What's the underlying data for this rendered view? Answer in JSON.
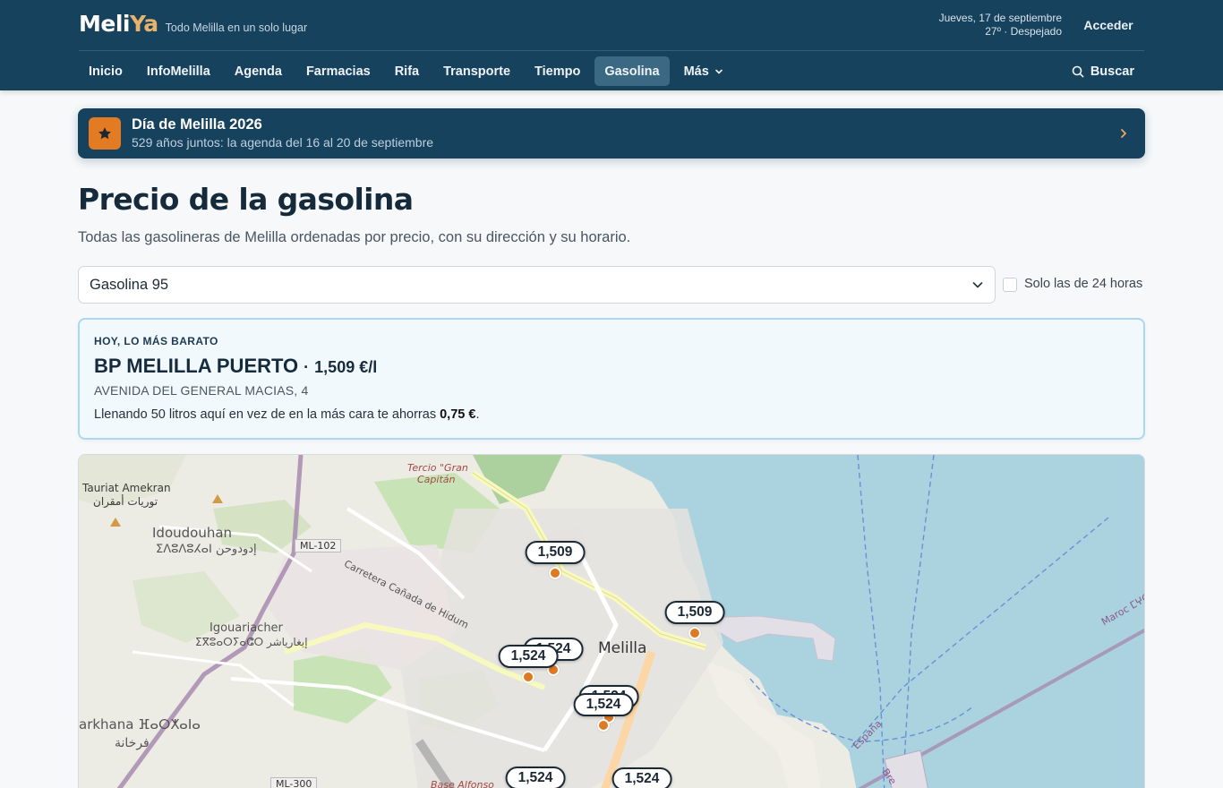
{
  "header": {
    "logo_part1": "Meli",
    "logo_part2": "Ya",
    "tagline": "Todo Melilla en un solo lugar",
    "date": "Jueves, 17 de septiembre",
    "weather": "27º · Despejado",
    "login_label": "Acceder",
    "nav": [
      "Inicio",
      "InfoMelilla",
      "Agenda",
      "Farmacias",
      "Rifa",
      "Transporte",
      "Tiempo",
      "Gasolina"
    ],
    "nav_more": "Más",
    "nav_active": "Gasolina",
    "search_label": "Buscar"
  },
  "banner": {
    "title": "Día de Melilla 2026",
    "subtitle": "529 años juntos: la agenda del 16 al 20 de septiembre"
  },
  "page": {
    "title": "Precio de la gasolina",
    "lead": "Todas las gasolineras de Melilla ordenadas por precio, con su dirección y su horario."
  },
  "filter": {
    "fuel_selected": "Gasolina 95",
    "only_24h_label": "Solo las de 24 horas",
    "only_24h_checked": false
  },
  "cheapest": {
    "kicker": "HOY, LO MÁS BARATO",
    "name": "BP MELILLA PUERTO",
    "separator": "·",
    "price": "1,509 €/l",
    "address": "AVENIDA DEL GENERAL MACIAS, 4",
    "saving_prefix": "Llenando 50 litros aquí en vez de en la más cara te ahorras",
    "saving_amount": "0,75 €",
    "saving_suffix": "."
  },
  "map": {
    "labels": {
      "tauriat": "Tauriat Amekran",
      "tauriat_ar": "توريات أمقران",
      "idoudouhan": "Idoudouhan",
      "idoudouhan_alt": "ⵉⴷⵓⴷⵓⵃⴰⵏ إدودوحن",
      "ml102": "ML-102",
      "carretera": "Carretera Cañada de Hidum",
      "tercio": "Tercio \"Gran",
      "capitan": "Capitán",
      "igouariacher": "Igouariacher",
      "igouariacher_alt": "ⵉⴳⵓⴰⵔⵢⴰⵛⵔ إيغارياشر",
      "melilla": "Melilla",
      "farkhana": "arkhana ⴼⴰⵔⵅⴰⵏⴰ",
      "farkhana_ar": "فرخانة",
      "ml300": "ML-300",
      "base_alfonso": "Base Alfonso",
      "espana": "España",
      "maroc": "Maroc ⵎⵖⵔⵉⴱ",
      "bren": "Bre"
    },
    "stations": [
      {
        "price": "1,509"
      },
      {
        "price": "1,509"
      },
      {
        "price": "1,524"
      },
      {
        "price": "1,524"
      },
      {
        "price": "1,524"
      },
      {
        "price": "1,524"
      },
      {
        "price": "1,524"
      },
      {
        "price": "1,524"
      }
    ]
  }
}
